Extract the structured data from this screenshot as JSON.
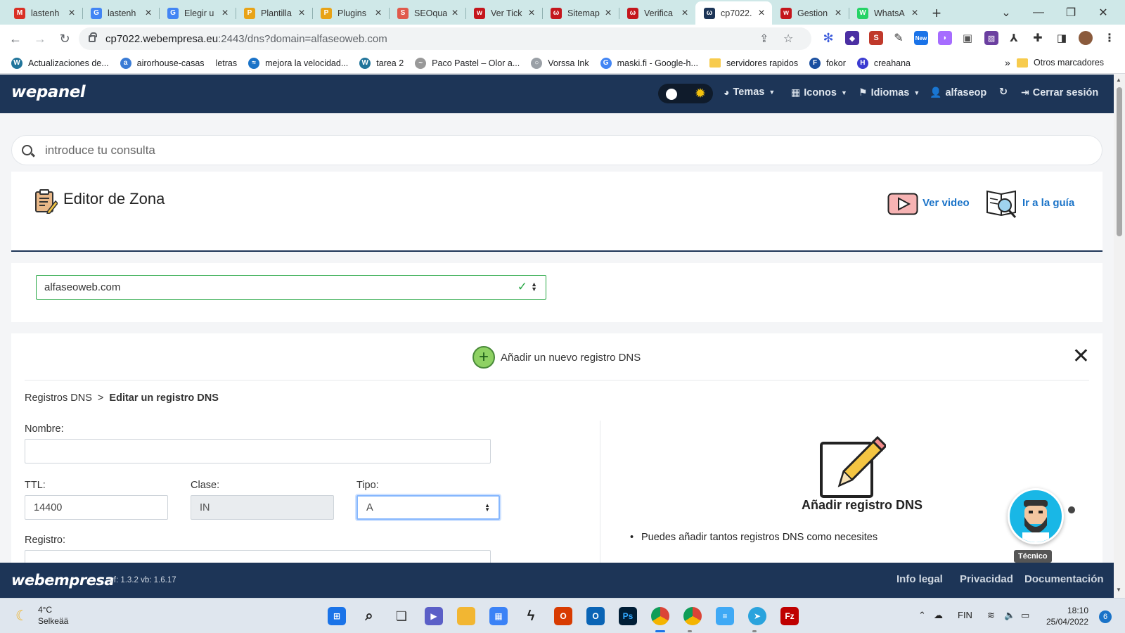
{
  "browser": {
    "tabs": [
      {
        "title": "lastenh",
        "icon": "gmail-icon",
        "color": "#d93025",
        "glyph": "M",
        "active": false
      },
      {
        "title": "lastenh",
        "icon": "google-icon",
        "color": "#4285f4",
        "glyph": "G",
        "active": false
      },
      {
        "title": "Elegir u",
        "icon": "google-icon",
        "color": "#4285f4",
        "glyph": "G",
        "active": false
      },
      {
        "title": "Plantilla",
        "icon": "plugin-icon",
        "color": "#e8a317",
        "glyph": "P",
        "active": false
      },
      {
        "title": "Plugins",
        "icon": "plugin-icon",
        "color": "#e8a317",
        "glyph": "P",
        "active": false
      },
      {
        "title": "SEOqua",
        "icon": "seoquake-icon",
        "color": "#e05a4c",
        "glyph": "S",
        "active": false
      },
      {
        "title": "Ver Tick",
        "icon": "webempresa-icon",
        "color": "#c4161c",
        "glyph": "w",
        "active": false
      },
      {
        "title": "Sitemap",
        "icon": "webempresa-icon",
        "color": "#c4161c",
        "glyph": "ω",
        "active": false
      },
      {
        "title": "Verifica",
        "icon": "webempresa-icon",
        "color": "#c4161c",
        "glyph": "ω",
        "active": false
      },
      {
        "title": "cp7022.",
        "icon": "wepanel-icon",
        "color": "#1d3557",
        "glyph": "ω",
        "active": true
      },
      {
        "title": "Gestion",
        "icon": "webempresa-icon",
        "color": "#c4161c",
        "glyph": "w",
        "active": false
      },
      {
        "title": "WhatsA",
        "icon": "whatsapp-icon",
        "color": "#25d366",
        "glyph": "W",
        "active": false
      }
    ],
    "url_host": "cp7022.webempresa.eu",
    "url_path": ":2443/dns?domain=alfaseoweb.com",
    "bookmarks": [
      {
        "label": "Actualizaciones de...",
        "icon": "wordpress-icon",
        "color": "#21759b",
        "glyph": "W"
      },
      {
        "label": "airorhouse-casas",
        "icon": "people-icon",
        "color": "#3a7bd5",
        "glyph": "a"
      },
      {
        "label": "letras",
        "icon": "",
        "color": "",
        "glyph": ""
      },
      {
        "label": "mejora la velocidad...",
        "icon": "speed-icon",
        "color": "#1a73c8",
        "glyph": "≈"
      },
      {
        "label": "tarea 2",
        "icon": "wordpress-icon",
        "color": "#21759b",
        "glyph": "W"
      },
      {
        "label": "Paco Pastel – Olor a...",
        "icon": "link-icon",
        "color": "#999",
        "glyph": "~"
      },
      {
        "label": "Vorssa Ink",
        "icon": "globe-icon",
        "color": "#9aa0a6",
        "glyph": "○"
      },
      {
        "label": "maski.fi - Google-h...",
        "icon": "google-icon",
        "color": "#4285f4",
        "glyph": "G"
      },
      {
        "label": "servidores rapidos",
        "icon": "folder-icon",
        "color": "#f7cb4d",
        "glyph": ""
      },
      {
        "label": "fokor",
        "icon": "f-icon",
        "color": "#1a4fa0",
        "glyph": "F"
      },
      {
        "label": "creahana",
        "icon": "creahana-icon",
        "color": "#3b3bd1",
        "glyph": "H"
      }
    ],
    "overflow": "»",
    "other_bookmarks": "Otros marcadores"
  },
  "header": {
    "logo": "wepanel",
    "temas": "Temas",
    "iconos": "Iconos",
    "idiomas": "Idiomas",
    "user": "alfaseop",
    "logout": "Cerrar sesión"
  },
  "search": {
    "placeholder": "introduce tu consulta"
  },
  "editor": {
    "title": "Editor de Zona",
    "video_link": "Ver video",
    "guide_link": "Ir a la guía"
  },
  "domain_select": {
    "value": "alfaseoweb.com"
  },
  "form": {
    "add_label": "Añadir un nuevo registro DNS",
    "breadcrumb_root": "Registros DNS",
    "breadcrumb_sep": ">",
    "breadcrumb_current": "Editar un registro DNS",
    "nombre_label": "Nombre:",
    "nombre_value": "",
    "ttl_label": "TTL:",
    "ttl_value": "14400",
    "clase_label": "Clase:",
    "clase_value": "IN",
    "tipo_label": "Tipo:",
    "tipo_value": "A",
    "registro_label": "Registro:"
  },
  "side_help": {
    "title": "Añadir registro DNS",
    "items": [
      "Puedes añadir tantos registros DNS como necesites"
    ]
  },
  "bot": {
    "label": "Técnico"
  },
  "footer": {
    "logo": "webempresa",
    "version": "vf: 1.3.2 vb: 1.6.17",
    "links": [
      "Info legal",
      "Privacidad",
      "Documentación"
    ]
  },
  "taskbar": {
    "temp": "4°C",
    "weather": "Selkeää",
    "lang": "FIN",
    "time": "18:10",
    "date": "25/04/2022",
    "notifications": "6"
  }
}
